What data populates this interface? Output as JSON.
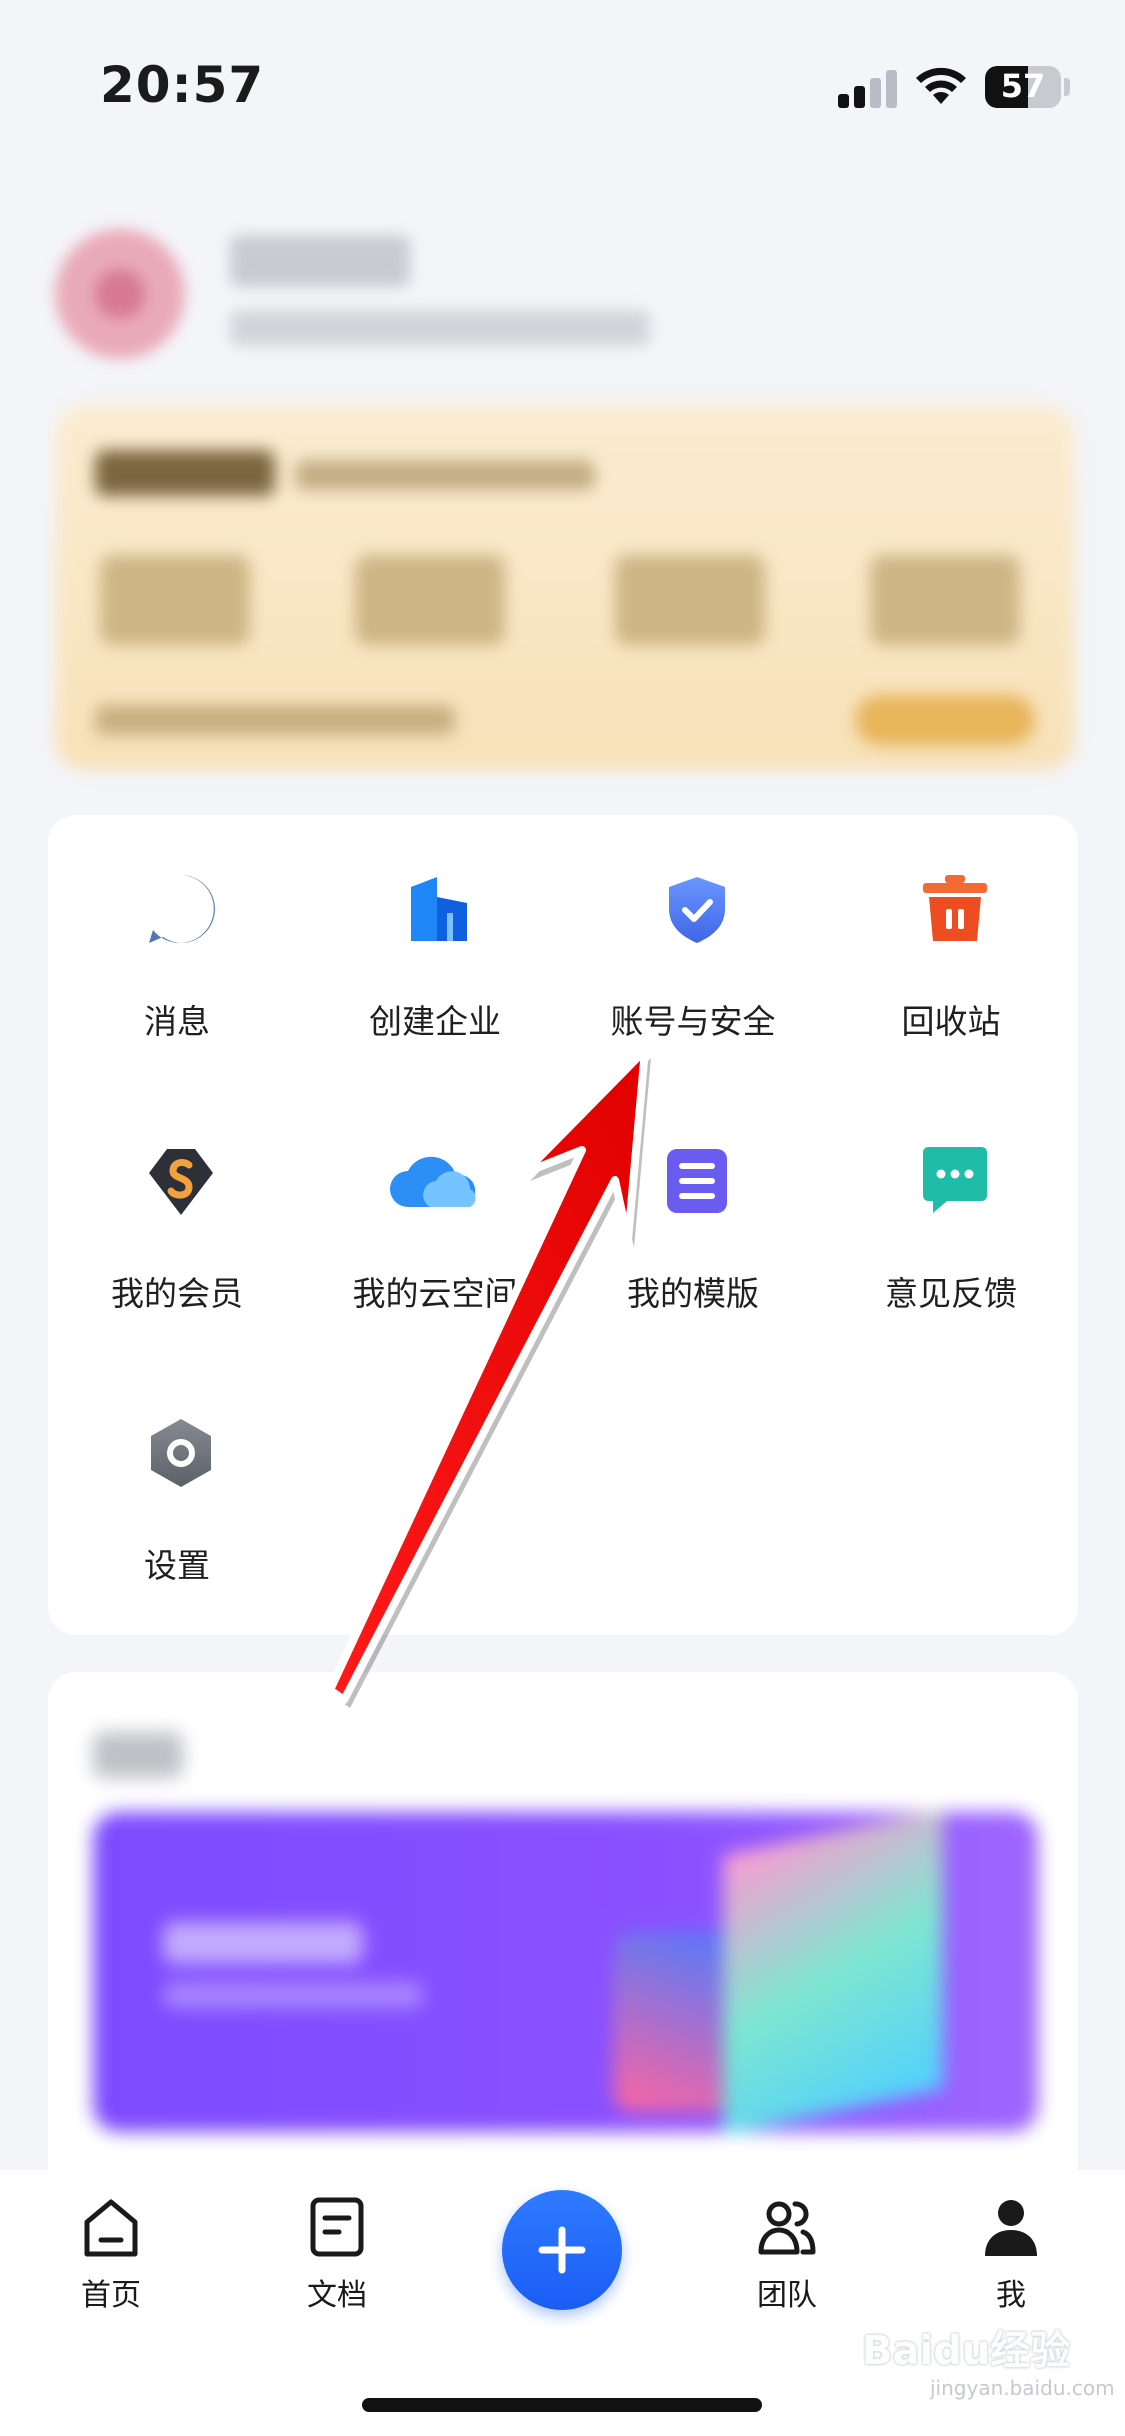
{
  "status_bar": {
    "time": "20:57",
    "battery": "57",
    "battery_level_percent": 57
  },
  "functions": [
    {
      "label": "消息",
      "icon": "message-icon",
      "color": "#5a86c3"
    },
    {
      "label": "创建企业",
      "icon": "building-icon",
      "color": "#1b73f0"
    },
    {
      "label": "账号与安全",
      "icon": "shield-icon",
      "color": "#4f7ff5"
    },
    {
      "label": "回收站",
      "icon": "trash-icon",
      "color": "#f0532a"
    },
    {
      "label": "我的会员",
      "icon": "vip-badge-icon",
      "color": "#f0a040"
    },
    {
      "label": "我的云空间",
      "icon": "cloud-icon",
      "color": "#2b8cf5"
    },
    {
      "label": "我的模版",
      "icon": "template-icon",
      "color": "#6b5cf0"
    },
    {
      "label": "意见反馈",
      "icon": "feedback-icon",
      "color": "#1fbca8"
    },
    {
      "label": "设置",
      "icon": "settings-icon",
      "color": "#6d737c"
    }
  ],
  "tab_bar": {
    "tabs": [
      {
        "label": "首页",
        "icon": "home-icon"
      },
      {
        "label": "文档",
        "icon": "document-icon"
      },
      {
        "label": "",
        "icon": "plus-icon"
      },
      {
        "label": "团队",
        "icon": "team-icon"
      },
      {
        "label": "我",
        "icon": "user-icon"
      }
    ],
    "accent_color": "#1a5cf5"
  },
  "watermark": {
    "text": "Baidu经验",
    "sub": "jingyan.baidu.com"
  }
}
